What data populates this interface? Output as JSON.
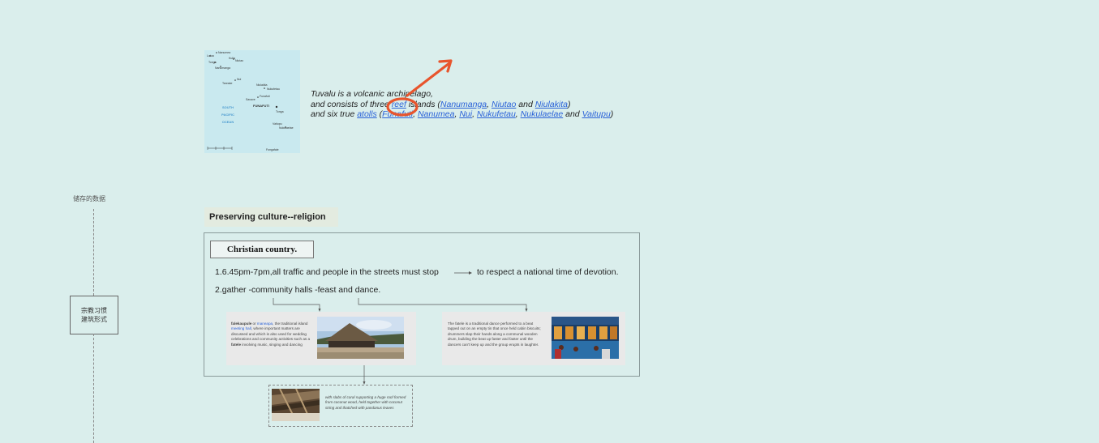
{
  "map": {
    "labels": [
      "Nanumea",
      "Lotua",
      "Kulia",
      "Niutao",
      "Tonga",
      "Nanumanga",
      "Nui",
      "Tanrake",
      "Niulakita",
      "Nukufetau",
      "Savave",
      "Funafuti",
      "FUNAFUTI",
      "Tonga",
      "Nukulaelae",
      "Vaitupu",
      "Fongafale",
      "SOUTH",
      "PACIFIC",
      "OCEAN"
    ]
  },
  "intro": {
    "line1": "Tuvalu is a volcanic archipelago,",
    "line2_prefix": "and consists of three ",
    "reef": "reef",
    "line2_mid": " islands (",
    "reef_islands": [
      "Nanumanga",
      "Niutao",
      "Niulakita"
    ],
    "and": "and",
    "close": ")",
    "line3_prefix": "and six true ",
    "atolls": "atolls",
    "atoll_islands": [
      "Funafuti",
      "Nanumea",
      "Nui",
      "Nukufetau",
      "Nukulaelae",
      "Vaitupu"
    ]
  },
  "tree": {
    "root": "储存的数据",
    "node_line1": "宗教习惯",
    "node_line2": "建筑形式"
  },
  "section": {
    "title": "Preserving culture--religion",
    "heading": "Christian country.",
    "point1": "1.6.45pm-7pm,all traffic and people in the streets must stop",
    "point1_result": "to respect a national time of devotion.",
    "point2": "2.gather -community halls -feast and dance."
  },
  "card1": {
    "term1": "falekaupule",
    "or": " or ",
    "term2": "maneapa",
    "desc1": ", the traditional island ",
    "link": "meeting hall",
    "desc2": ", where important matters are discussed and which is also used for wedding celebrations and community activities such as a ",
    "term3": "fatele",
    "desc3": " involving music, singing and dancing"
  },
  "card2": {
    "text": "The fatele is a traditional dance performed to a beat tapped out on an empty tin that once held cabin biscuits; drummers slap their hands along a communal wooden drum, building the beat up faster and faster until the dancers can't keep up and the group erupts in laughter."
  },
  "card3": {
    "text": "with slabs of coral supporting a huge roof formed from coconut wood, held together with coconut string and thatched with pandanus leaves"
  },
  "colors": {
    "background": "#daeeec",
    "annotation": "#e8552d",
    "link": "#2a62d8"
  }
}
